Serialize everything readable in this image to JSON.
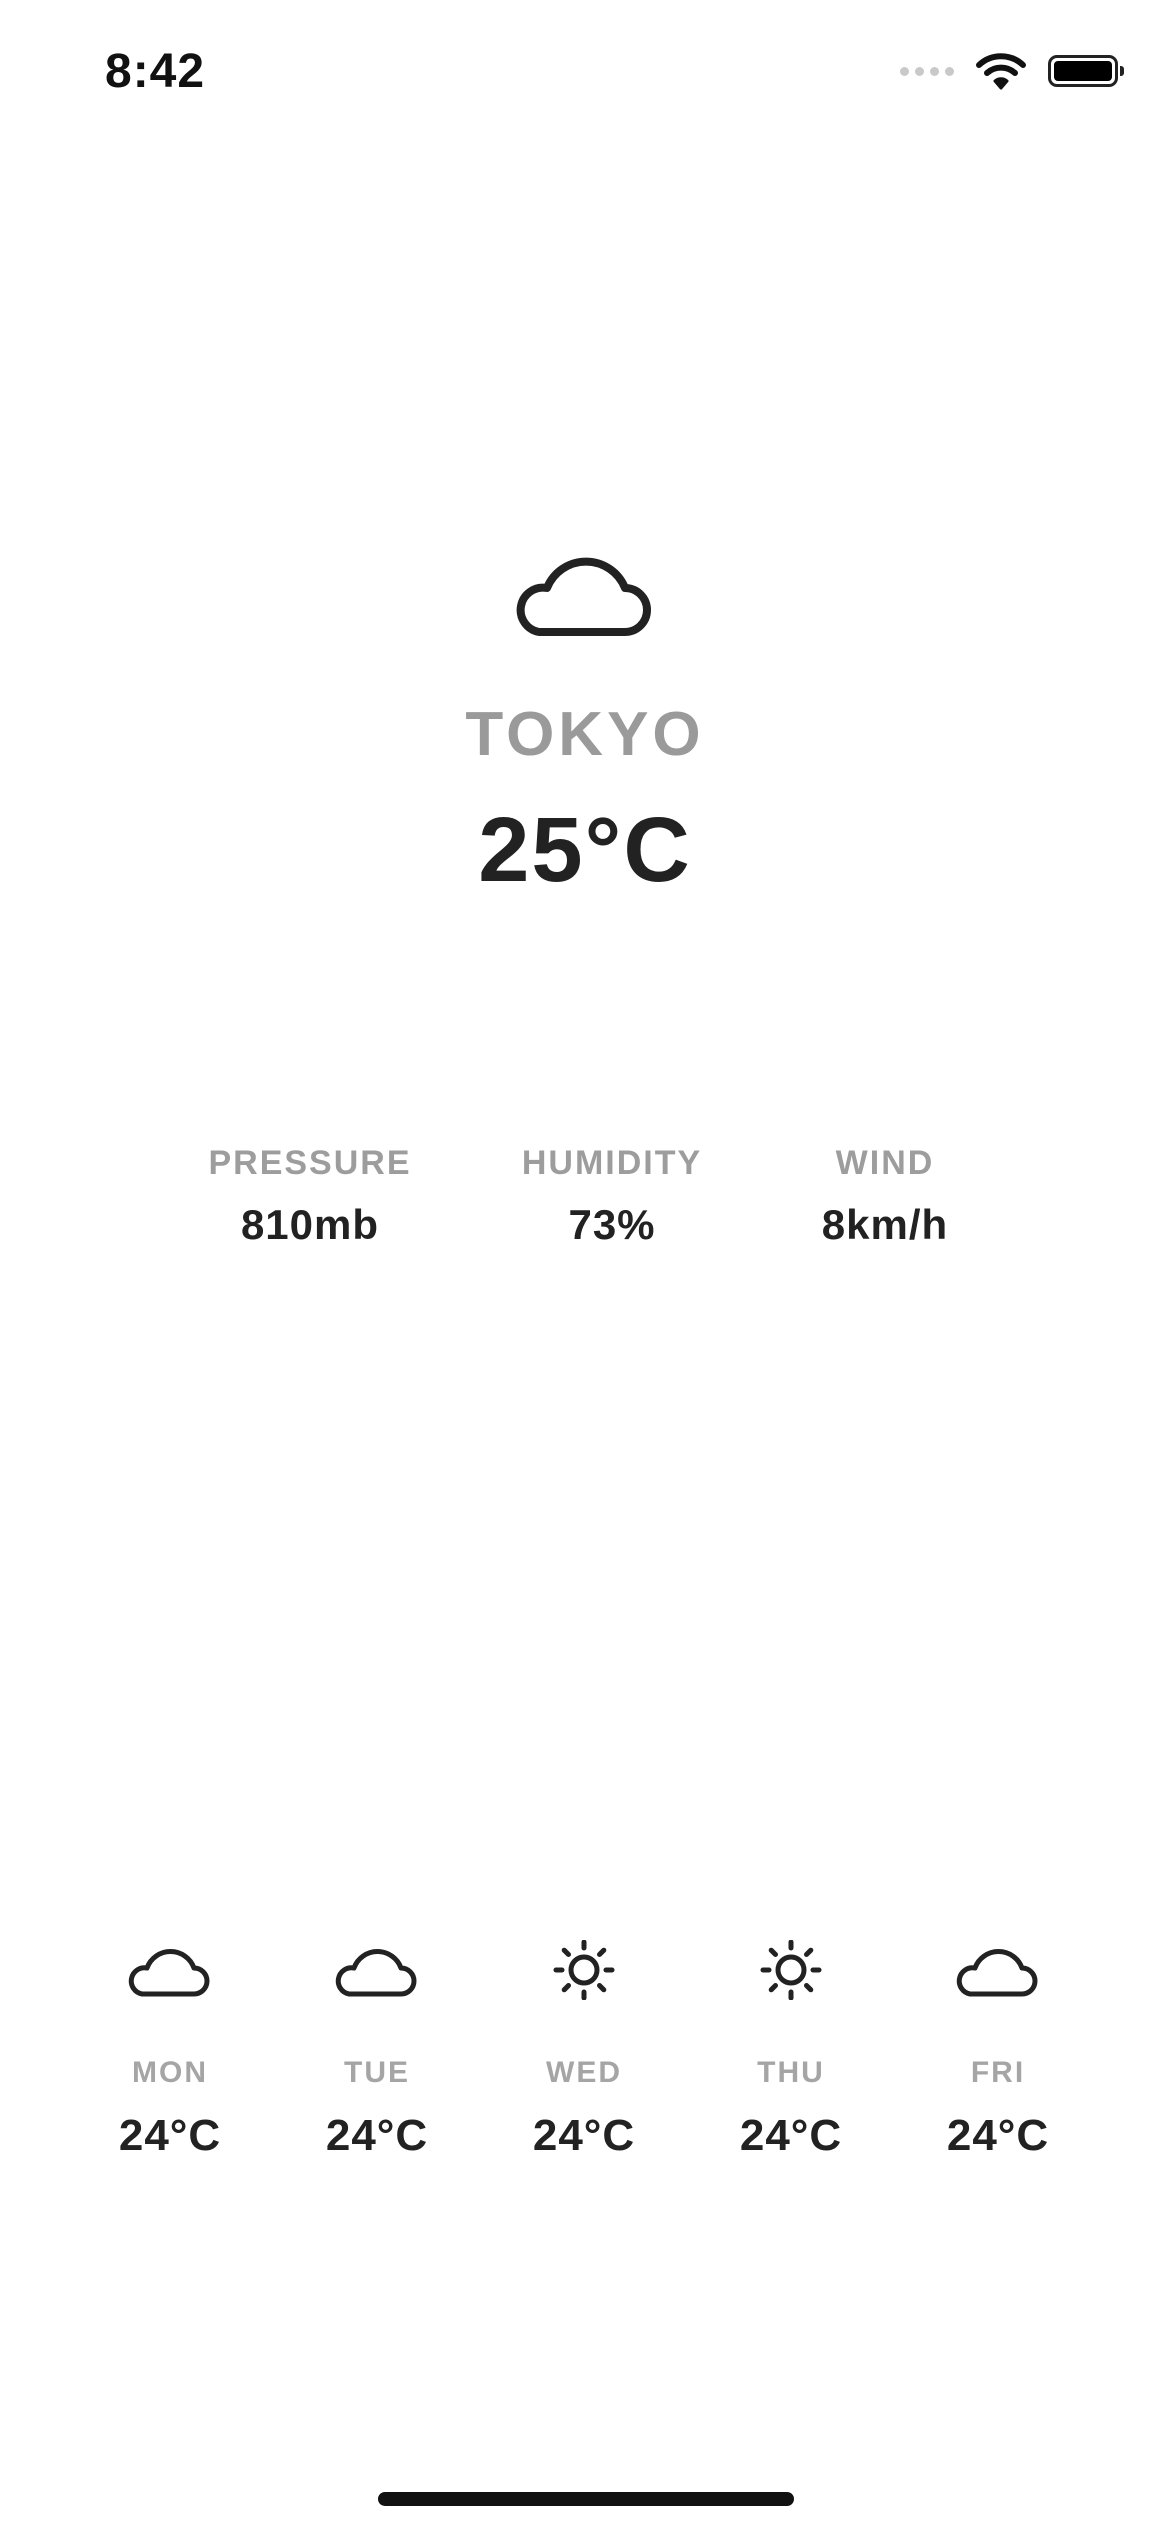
{
  "status_bar": {
    "time": "8:42",
    "icons": [
      "signal-dots-icon",
      "wifi-icon",
      "battery-icon"
    ]
  },
  "current": {
    "icon": "cloud-icon",
    "city": "TOKYO",
    "temperature": "25°C"
  },
  "details": [
    {
      "label": "PRESSURE",
      "value": "810mb"
    },
    {
      "label": "HUMIDITY",
      "value": "73%"
    },
    {
      "label": "WIND",
      "value": "8km/h"
    }
  ],
  "forecast": [
    {
      "day": "MON",
      "temp": "24°C",
      "icon": "cloud-icon"
    },
    {
      "day": "TUE",
      "temp": "24°C",
      "icon": "cloud-icon"
    },
    {
      "day": "WED",
      "temp": "24°C",
      "icon": "sun-icon"
    },
    {
      "day": "THU",
      "temp": "24°C",
      "icon": "sun-icon"
    },
    {
      "day": "FRI",
      "temp": "24°C",
      "icon": "cloud-icon"
    }
  ],
  "colors": {
    "text_primary": "#222222",
    "text_secondary": "#9a9a9a",
    "background": "#ffffff"
  }
}
